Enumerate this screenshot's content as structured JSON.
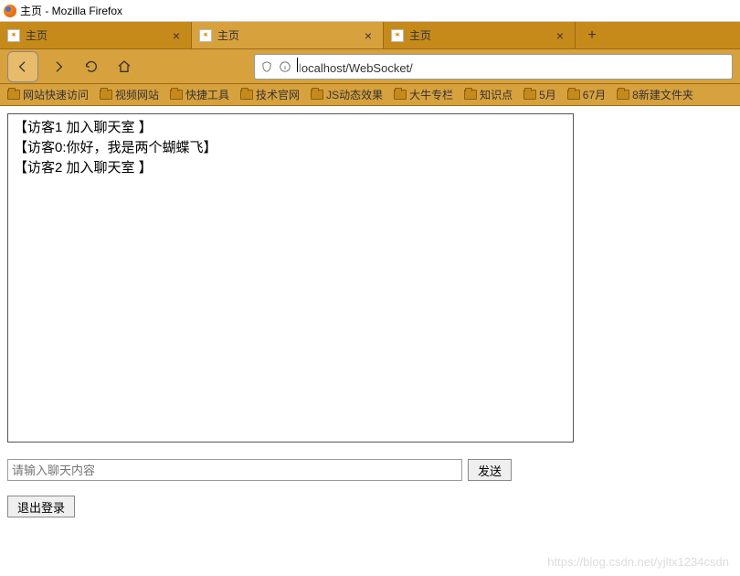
{
  "window": {
    "title": "主页 - Mozilla Firefox"
  },
  "tabs": [
    {
      "label": "主页",
      "active": false
    },
    {
      "label": "主页",
      "active": true
    },
    {
      "label": "主页",
      "active": false
    }
  ],
  "url": {
    "gray_prefix": "l",
    "rest": "ocalhost/WebSocket/"
  },
  "bookmarks": [
    {
      "label": "网站快速访问"
    },
    {
      "label": "视频网站"
    },
    {
      "label": "快捷工具"
    },
    {
      "label": "技术官网"
    },
    {
      "label": "JS动态效果"
    },
    {
      "label": "大牛专栏"
    },
    {
      "label": "知识点"
    },
    {
      "label": "5月"
    },
    {
      "label": "67月"
    },
    {
      "label": "8新建文件夹"
    }
  ],
  "chat": {
    "messages": [
      "【访客1 加入聊天室 】",
      "【访客0:你好，我是两个蝴蝶飞】",
      "【访客2 加入聊天室 】"
    ],
    "input_placeholder": "请输入聊天内容",
    "send_label": "发送",
    "logout_label": "退出登录"
  },
  "watermark": "https://blog.csdn.net/yjltx1234csdn"
}
